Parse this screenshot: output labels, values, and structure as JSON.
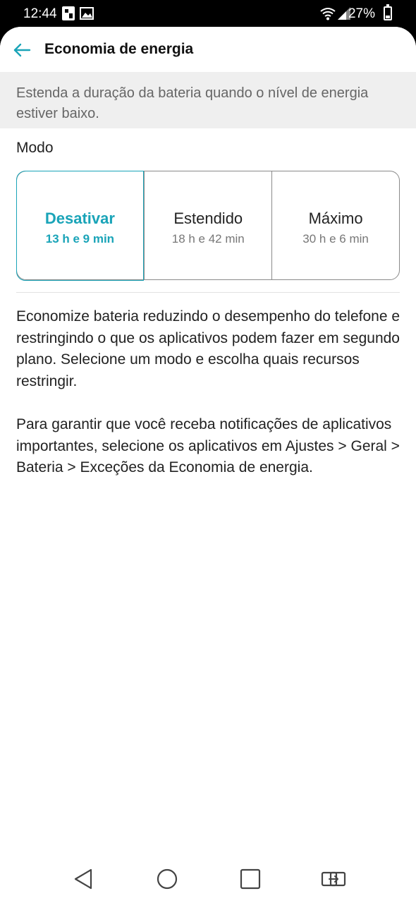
{
  "status_bar": {
    "time": "12:44",
    "battery": "27%",
    "battery_level": 0.27,
    "icons": [
      "sim-card-icon",
      "image-icon",
      "wifi-icon",
      "signal-icon",
      "battery-icon"
    ]
  },
  "header": {
    "back_icon": "arrow-left-icon",
    "title": "Economia de energia"
  },
  "banner": "Estenda a duração da bateria quando o nível de energia estiver baixo.",
  "mode": {
    "label": "Modo",
    "options": [
      {
        "name": "Desativar",
        "time": "13 h e 9 min",
        "selected": true
      },
      {
        "name": "Estendido",
        "time": "18 h e 42 min",
        "selected": false
      },
      {
        "name": "Máximo",
        "time": "30 h e 6 min",
        "selected": false
      }
    ]
  },
  "descriptions": [
    "Economize bateria reduzindo o desempenho do telefone e restringindo o que os aplicativos podem fazer em segundo plano. Selecione um modo e escolha quais recursos restringir.",
    "Para garantir que você receba notificações de aplicativos importantes, selecione os aplicativos em Ajustes > Geral > Bateria > Exceções da Economia de energia."
  ],
  "colors": {
    "accent": "#1aa4b8",
    "banner_bg": "#efefef",
    "text": "#222222"
  },
  "navbar": {
    "icons": [
      "back-triangle-icon",
      "home-circle-icon",
      "recents-square-icon",
      "dual-window-icon"
    ]
  }
}
